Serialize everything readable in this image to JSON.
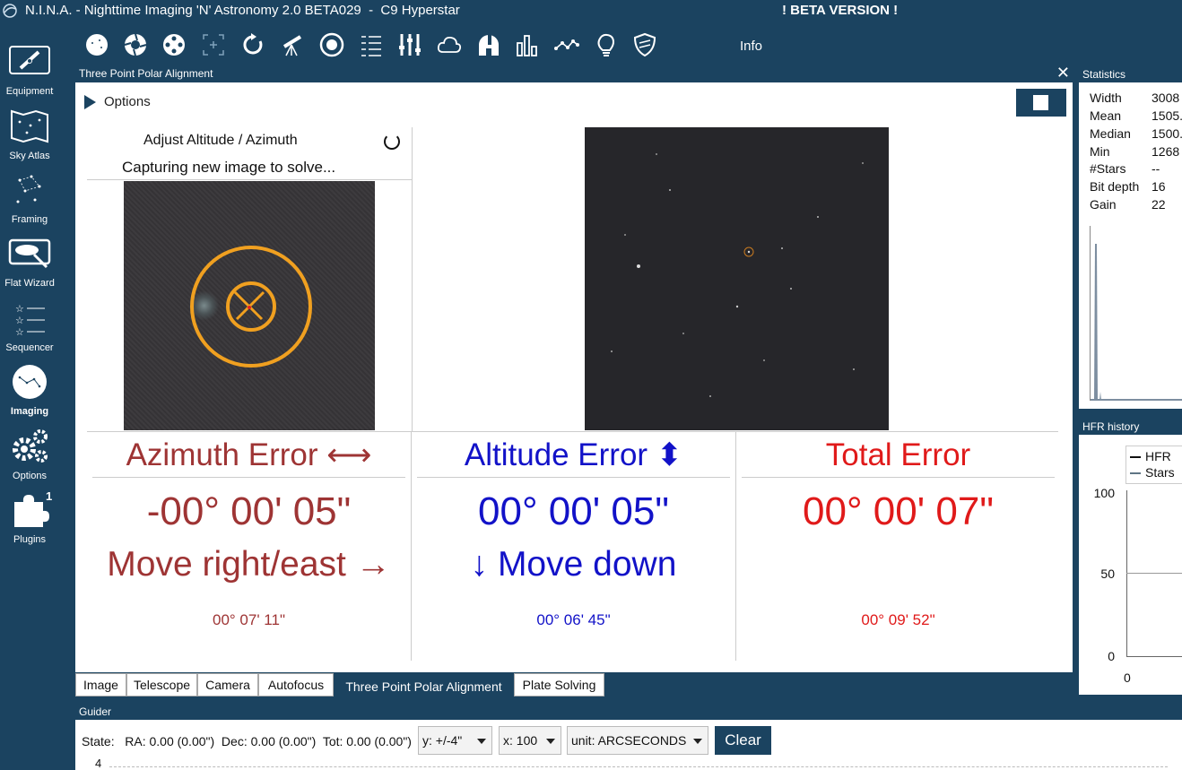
{
  "window": {
    "title": "N.I.N.A. - Nighttime Imaging 'N' Astronomy 2.0 BETA029  -  C9 Hyperstar",
    "beta_label": "! BETA VERSION !"
  },
  "sidenav": {
    "items": [
      {
        "label": "Equipment",
        "icon": "telescope-box-icon"
      },
      {
        "label": "Sky Atlas",
        "icon": "sky-atlas-icon"
      },
      {
        "label": "Framing",
        "icon": "framing-icon"
      },
      {
        "label": "Flat Wizard",
        "icon": "flat-wizard-icon"
      },
      {
        "label": "Sequencer",
        "icon": "sequencer-icon"
      },
      {
        "label": "Imaging",
        "icon": "imaging-icon"
      },
      {
        "label": "Options",
        "icon": "gears-icon"
      },
      {
        "label": "Plugins",
        "icon": "puzzle-icon",
        "badge": "1"
      }
    ],
    "active": "Imaging"
  },
  "toolbar": {
    "icons": [
      "image-icon",
      "camera-aperture-icon",
      "filter-wheel-icon",
      "focus-target-icon",
      "rotator-icon",
      "telescope-icon",
      "guider-icon",
      "switch-list-icon",
      "equalizer-icon",
      "cloud-icon",
      "observatory-icon",
      "bar-chart-icon",
      "hfr-graph-icon",
      "bulb-icon",
      "shield-icon"
    ],
    "info_label": "Info"
  },
  "panel": {
    "title": "Three Point Polar Alignment",
    "options_label": "Options",
    "status_line1": "Adjust Altitude / Azimuth",
    "status_line2": "Capturing new image to solve..."
  },
  "errors": {
    "azimuth": {
      "title": "Azimuth Error ⟷",
      "value": "-00° 00' 05\"",
      "direction": "Move right/east →",
      "initial": "00° 07' 11\""
    },
    "altitude": {
      "title": "Altitude Error ⬍",
      "value": "00° 00' 05\"",
      "direction": "↓ Move down",
      "initial": "00° 06' 45\""
    },
    "total": {
      "title": "Total Error",
      "value": "00° 00' 07\"",
      "direction": "",
      "initial": "00° 09' 52\""
    }
  },
  "tabs": [
    "Image",
    "Telescope",
    "Camera",
    "Autofocus",
    "Three Point Polar Alignment",
    "Plate Solving"
  ],
  "active_tab": "Three Point Polar Alignment",
  "guider": {
    "title": "Guider",
    "state_text": "State:   RA: 0.00 (0.00\")  Dec: 0.00 (0.00\")  Tot: 0.00 (0.00\")",
    "y_select": "y: +/-4\"",
    "x_select": "x: 100",
    "unit_select": "unit: ARCSECONDS",
    "clear_label": "Clear",
    "tick": "4"
  },
  "statistics": {
    "title": "Statistics",
    "rows": [
      {
        "k": "Width",
        "v": "3008"
      },
      {
        "k": "Mean",
        "v": "1505."
      },
      {
        "k": "Median",
        "v": "1500."
      },
      {
        "k": "Min",
        "v": "1268"
      },
      {
        "k": "#Stars",
        "v": "--"
      },
      {
        "k": "Bit depth",
        "v": "16"
      },
      {
        "k": "Gain",
        "v": "22"
      }
    ]
  },
  "hfr_history": {
    "title": "HFR history",
    "legend": [
      "HFR",
      "Stars"
    ],
    "y_ticks": [
      "100",
      "50",
      "0"
    ],
    "x_tick": "0"
  },
  "colors": {
    "chrome": "#1b4360",
    "azimuth": "#9e3434",
    "altitude": "#1212c8",
    "total": "#e01a1a",
    "target_ring": "#f0a020"
  }
}
